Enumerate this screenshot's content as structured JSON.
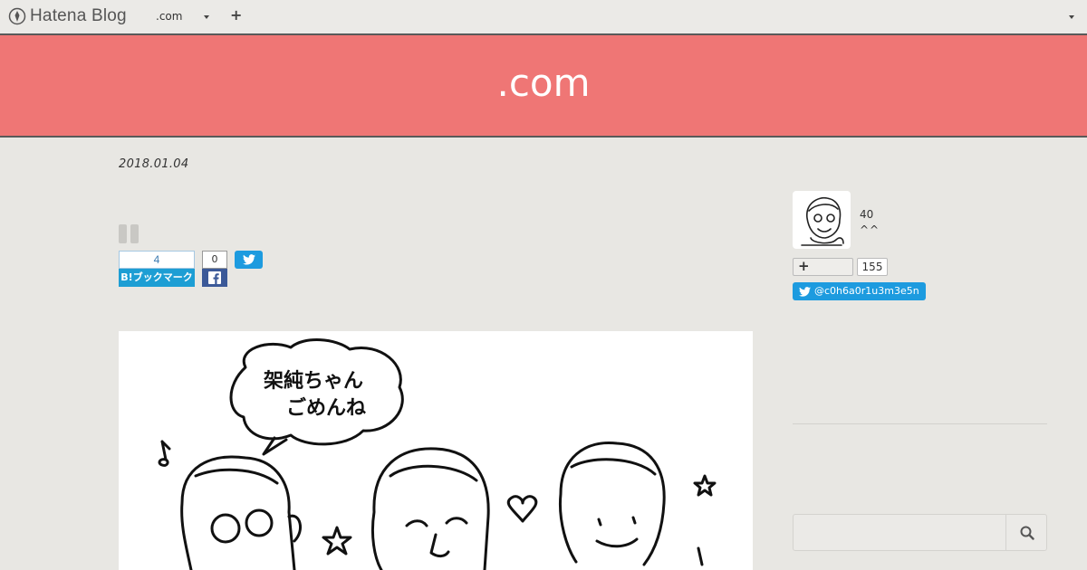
{
  "topbar": {
    "brand": "Hatena Blog",
    "blog_switch_label": ".com"
  },
  "header": {
    "title": ".com"
  },
  "entry": {
    "date": "2018.01.04",
    "hatena_bookmark": {
      "count": "4",
      "label": "B!ブックマーク"
    },
    "facebook": {
      "count": "0"
    },
    "illustration_text": [
      "架純ちゃん",
      "ごめんね"
    ]
  },
  "sidebar": {
    "profile": {
      "count": "40",
      "description": "^^"
    },
    "follow": {
      "count": "155"
    },
    "twitter": {
      "handle": "@c0h6a0r1u3m3e5n"
    },
    "search": {
      "placeholder": ""
    }
  },
  "colors": {
    "header_bg": "#ef7675",
    "hatena_blue": "#1d9ed4",
    "facebook_blue": "#3b5998",
    "twitter_blue": "#1d9bdf"
  }
}
